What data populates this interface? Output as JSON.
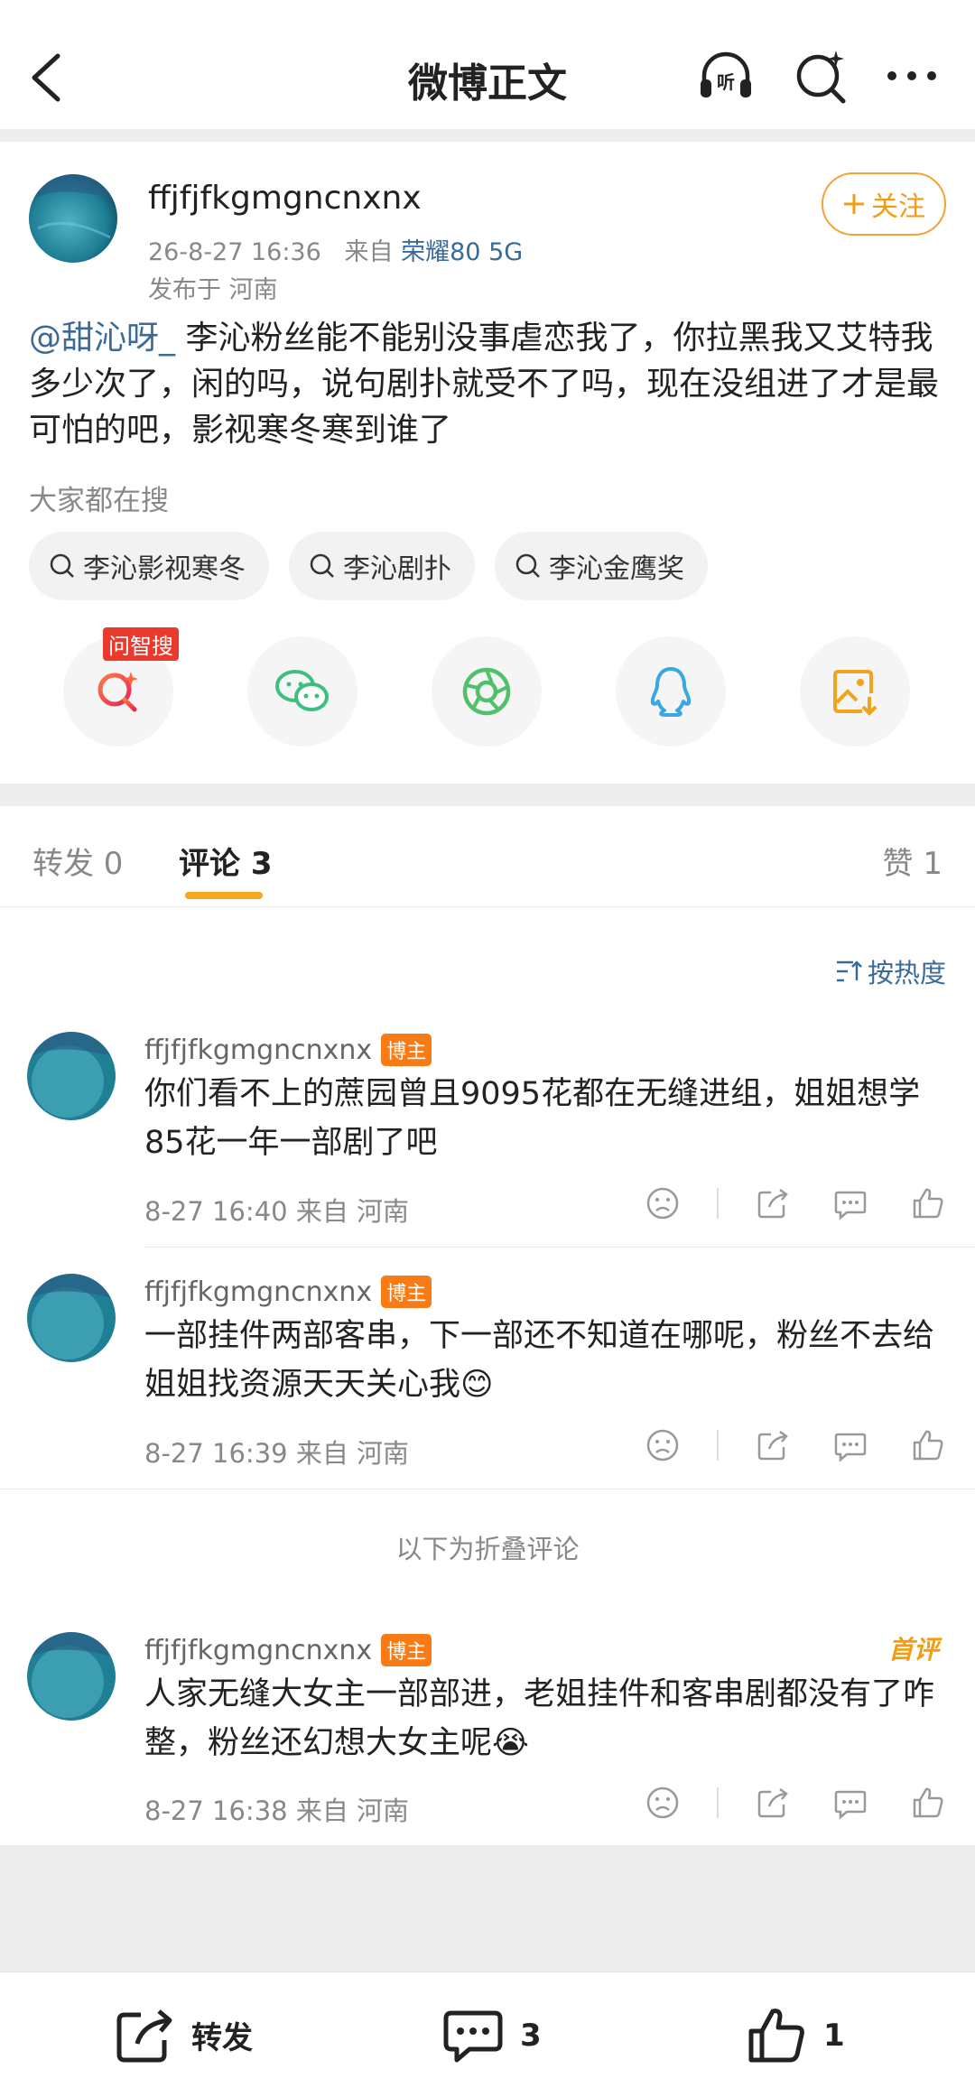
{
  "nav": {
    "title": "微博正文"
  },
  "post": {
    "username": "ffjfjfkgmgncnxnx",
    "time": "26-8-27 16:36",
    "from_label": "来自",
    "source": "荣耀80 5G",
    "location": "发布于 河南",
    "follow_label": "关注",
    "mention": "@甜沁呀_",
    "text": " 李沁粉丝能不能别没事虐恋我了，你拉黑我又艾特我多少次了，闲的吗，说句剧扑就受不了吗，现在没组进了才是最可怕的吧，影视寒冬寒到谁了",
    "search_label": "大家都在搜",
    "search_chips": [
      "李沁影视寒冬",
      "李沁剧扑",
      "李沁金鹰奖"
    ],
    "share_badge": "问智搜"
  },
  "tabs": {
    "repost": "转发 0",
    "comment": "评论 3",
    "like": "赞 1"
  },
  "sort_label": "按热度",
  "comments": [
    {
      "username": "ffjfjfkgmgncnxnx",
      "badge": "博主",
      "text": "你们看不上的蔗园曾且9095花都在无缝进组，姐姐想学85花一年一部剧了吧",
      "meta": "8-27 16:40 来自 河南"
    },
    {
      "username": "ffjfjfkgmgncnxnx",
      "badge": "博主",
      "text": "一部挂件两部客串，下一部还不知道在哪呢，粉丝不去给姐姐找资源天天关心我😊",
      "meta": "8-27 16:39 来自 河南"
    },
    {
      "username": "ffjfjfkgmgncnxnx",
      "badge": "博主",
      "text": "人家无缝大女主一部部进，老姐挂件和客串剧都没有了咋整，粉丝还幻想大女主呢😭",
      "meta": "8-27 16:38 来自 河南",
      "tag": "首评"
    }
  ],
  "folded_label": "以下为折叠评论",
  "bottom": {
    "repost": "转发",
    "comment_count": "3",
    "like_count": "1"
  }
}
